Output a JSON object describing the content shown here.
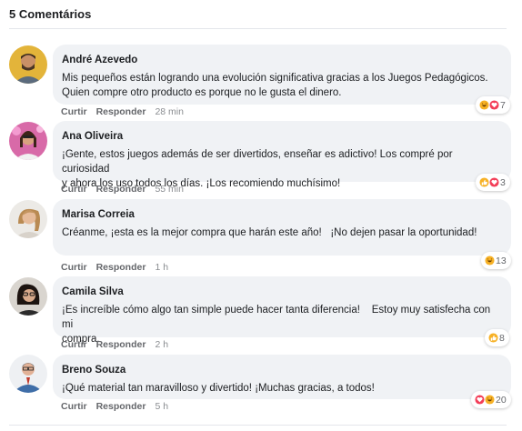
{
  "header": {
    "title": "5 Comentários"
  },
  "colors": {
    "bubble": "#f0f2f5",
    "muted": "#65676b",
    "like_blue": "#1877f2",
    "love_red": "#f33e58",
    "haha_yellow": "#f7b125"
  },
  "comments": [
    {
      "name": "André Azevedo",
      "text": "Mis pequeños están logrando una evolución significativa gracias a los Juegos Pedagógicos.\nQuien compre otro producto es porque no le gusta el dinero.",
      "like": "Curtir",
      "reply": "Responder",
      "time": "28 min",
      "reactions": [
        "haha-icon",
        "love-icon"
      ],
      "count": "7"
    },
    {
      "name": "Ana Oliveira",
      "text": "¡Gente, estos juegos además de ser divertidos, enseñar es adictivo! Los compré por curiosidad\ny ahora los uso todos los días. ¡Los recomiendo muchísimo!",
      "like": "Curtir",
      "reply": "Responder",
      "time": "55 min",
      "reactions": [
        "like-icon",
        "love-icon"
      ],
      "count": "3"
    },
    {
      "name": "Marisa Correia",
      "text": "Créanme, ¡esta es la mejor compra que harán este año!   ¡No dejen pasar la oportunidad!",
      "like": "Curtir",
      "reply": "Responder",
      "time": "1 h",
      "reactions": [
        "haha-icon"
      ],
      "count": "13"
    },
    {
      "name": "Camila Silva",
      "text": "¡Es increíble cómo algo tan simple puede hacer tanta diferencia!    Estoy muy satisfecha con mi\ncompra.",
      "like": "Curtir",
      "reply": "Responder",
      "time": "2 h",
      "reactions": [
        "like-icon"
      ],
      "count": "8"
    },
    {
      "name": "Breno Souza",
      "text": "¡Qué material tan maravilloso y divertido! ¡Muchas gracias, a todos!",
      "like": "Curtir",
      "reply": "Responder",
      "time": "5 h",
      "reactions": [
        "love-icon",
        "haha-icon"
      ],
      "count": "20"
    }
  ]
}
